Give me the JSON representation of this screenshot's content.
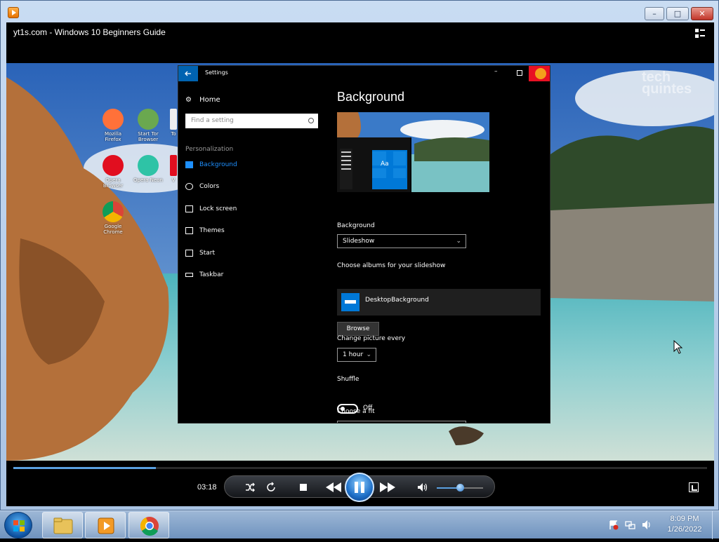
{
  "window": {
    "app_icon": "media-player-icon",
    "caption_buttons": {
      "minimize": "–",
      "maximize": "□",
      "close": "✕"
    }
  },
  "video": {
    "title": "yt1s.com - Windows 10 Beginners Guide",
    "watermark": "tech quintes",
    "desktop_icons": [
      {
        "label": "Mozilla Firefox",
        "color": "#ff7139"
      },
      {
        "label": "Start Tor Browser",
        "color": "#7e4798"
      },
      {
        "label": "To",
        "color": "#7e4798"
      },
      {
        "label": "Opera Browser",
        "color": "#e10e1f"
      },
      {
        "label": "Opera Neon",
        "color": "#2ec3a6"
      },
      {
        "label": "V",
        "color": "#e10e1f"
      },
      {
        "label": "Google Chrome",
        "color": "#4285f4"
      }
    ]
  },
  "settings": {
    "title": "Settings",
    "home_label": "Home",
    "search_placeholder": "Find a setting",
    "category": "Personalization",
    "nav": [
      {
        "label": "Background",
        "icon": "image-icon",
        "active": true
      },
      {
        "label": "Colors",
        "icon": "palette-icon",
        "active": false
      },
      {
        "label": "Lock screen",
        "icon": "monitor-icon",
        "active": false
      },
      {
        "label": "Themes",
        "icon": "brush-icon",
        "active": false
      },
      {
        "label": "Start",
        "icon": "start-icon",
        "active": false
      },
      {
        "label": "Taskbar",
        "icon": "taskbar-icon",
        "active": false
      }
    ],
    "heading": "Background",
    "preview_tile_text": "Aa",
    "background_label": "Background",
    "background_value": "Slideshow",
    "albums_label": "Choose albums for your slideshow",
    "album_name": "DesktopBackground",
    "browse_label": "Browse",
    "change_label": "Change picture every",
    "change_value": "1 hour",
    "shuffle_label": "Shuffle",
    "shuffle_state": "Off",
    "fit_label": "Choose a fit"
  },
  "player": {
    "time": "03:18",
    "progress": 0.205,
    "volume": 0.5,
    "buttons": {
      "shuffle": "shuffle-icon",
      "repeat": "repeat-icon",
      "stop": "stop-icon",
      "previous": "rewind-icon",
      "play_pause": "pause-icon",
      "next": "fast-forward-icon",
      "mute": "speaker-icon",
      "fullscreen": "fullscreen-icon"
    }
  },
  "taskbar": {
    "pinned": [
      "windows-explorer-icon",
      "media-player-icon",
      "chrome-icon"
    ],
    "clock_time": "8:09 PM",
    "clock_date": "1/26/2022"
  },
  "colors": {
    "accent_blue": "#0078d7",
    "settings_bg": "#000000",
    "close_red": "#e81123",
    "player_progress": "#5aa0e0"
  }
}
